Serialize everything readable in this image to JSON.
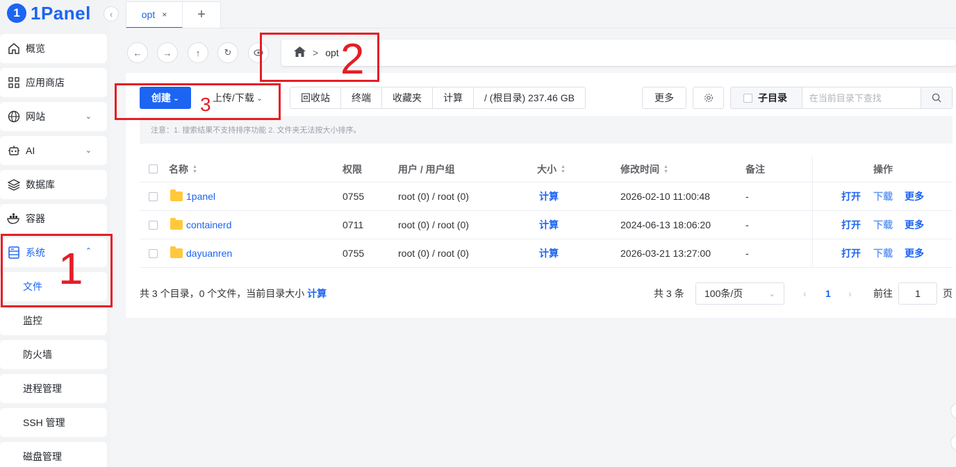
{
  "brand": {
    "logo_glyph": "1",
    "name": "1Panel",
    "accent": "#1c64f2"
  },
  "sidebar": {
    "items": [
      {
        "label": "概览",
        "icon": "home-icon"
      },
      {
        "label": "应用商店",
        "icon": "grid-icon"
      },
      {
        "label": "网站",
        "icon": "globe-icon",
        "chevron": "down"
      },
      {
        "label": "AI",
        "icon": "robot-icon",
        "chevron": "down"
      },
      {
        "label": "数据库",
        "icon": "layers-icon"
      },
      {
        "label": "容器",
        "icon": "docker-icon"
      },
      {
        "label": "系统",
        "icon": "server-icon",
        "chevron": "up",
        "active": true
      }
    ],
    "sub_items": [
      "文件",
      "监控",
      "防火墙",
      "进程管理",
      "SSH 管理",
      "磁盘管理"
    ],
    "active_sub": "文件"
  },
  "tabs": [
    {
      "label": "opt",
      "close": "×"
    }
  ],
  "tab_add": "+",
  "path": {
    "segments": [
      "opt"
    ],
    "separator": ">"
  },
  "toolbar": {
    "create_label": "创建",
    "upload_label": "上传/下载",
    "group": [
      "回收站",
      "终端",
      "收藏夹",
      "计算",
      "/ (根目录) 237.46 GB"
    ],
    "more_label": "更多",
    "subdir_label": "子目录",
    "search_placeholder": "在当前目录下查找"
  },
  "notice": "注意：1. 搜索结果不支持排序功能 2. 文件夹无法按大小排序。",
  "table": {
    "columns": {
      "name": "名称",
      "perm": "权限",
      "owner": "用户 / 用户组",
      "size": "大小",
      "mtime": "修改时间",
      "remark": "备注",
      "ops": "操作"
    },
    "rows": [
      {
        "name": "1panel",
        "perm": "0755",
        "owner": "root (0) / root (0)",
        "size": "计算",
        "mtime": "2026-02-10 11:00:48",
        "remark": "-"
      },
      {
        "name": "containerd",
        "perm": "0711",
        "owner": "root (0) / root (0)",
        "size": "计算",
        "mtime": "2024-06-13 18:06:20",
        "remark": "-"
      },
      {
        "name": "dayuanren",
        "perm": "0755",
        "owner": "root (0) / root (0)",
        "size": "计算",
        "mtime": "2026-03-21 13:27:00",
        "remark": "-"
      }
    ],
    "row_actions": {
      "open": "打开",
      "download": "下载",
      "more": "更多"
    }
  },
  "footer": {
    "summary": "共 3 个目录，0 个文件，当前目录大小",
    "summary_link": "计算",
    "total": "共 3 条",
    "page_size": "100条/页",
    "current_page": "1",
    "goto_label": "前往",
    "goto_value": "1",
    "page_suffix": "页"
  },
  "annotations": [
    "1",
    "2",
    "3"
  ]
}
